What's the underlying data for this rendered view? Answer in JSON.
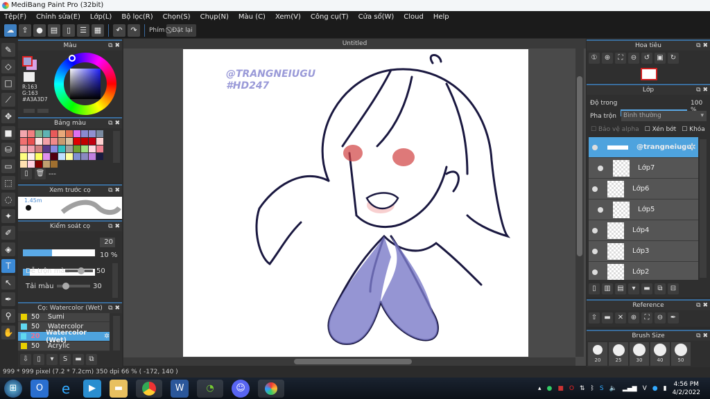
{
  "app": {
    "title": "MediBang Paint Pro (32bit)"
  },
  "menu": [
    "Tệp(F)",
    "Chỉnh sửa(E)",
    "Lớp(L)",
    "Bộ lọc(R)",
    "Chọn(S)",
    "Chụp(N)",
    "Màu (C)",
    "Xem(V)",
    "Công cụ(T)",
    "Cửa sổ(W)",
    "Cloud",
    "Help"
  ],
  "toolbar": {
    "shortcut_label": "Phím",
    "reset_label": "Đặt lại"
  },
  "color_panel": {
    "title": "Màu",
    "r": "R:163",
    "g": "G:163",
    "hex": "#A3A3D7",
    "primary": "#a3a3d7",
    "secondary": "#d7a3e6"
  },
  "palette_panel": {
    "title": "Bảng màu",
    "empty_label": "---",
    "colors": [
      "#f4a6ad",
      "#f08080",
      "#7fb18a",
      "#5fb3b3",
      "#e85a5a",
      "#e8a97a",
      "#e07050",
      "#e070f0",
      "#8a8ad0",
      "#9090d0",
      "#7a8aa0",
      "#f07070",
      "#e85050",
      "#ffe0e0",
      "#f4a0a8",
      "#f08a8a",
      "#c89a70",
      "#d8c0a0",
      "#e00000",
      "#c00000",
      "#c00010",
      "#ffd0d0",
      "#f0b0b0",
      "#f4a0b0",
      "#d08080",
      "#5a3a8a",
      "#8a8ae0",
      "#30c0c0",
      "#a0a0a0",
      "#70a030",
      "#a0e080",
      "#ffd8e0",
      "#f08090",
      "#ffff80",
      "#fff0f0",
      "#ffff60",
      "#e090f0",
      "#500010",
      "#c0e0ff",
      "#ffffa0",
      "#8090d0",
      "#8a8ac0",
      "#c080e0",
      "#1a1a40",
      "#ffe0b0",
      "#ffd0e0",
      "#800000",
      "#c0a070",
      "#a07030"
    ]
  },
  "brush_preview": {
    "title": "Xem trước cọ",
    "size": "1.45m"
  },
  "brush_control": {
    "title": "Kiểm soát cọ",
    "size_value": "20",
    "size_fraction": 0.4,
    "opacity_value": "10 %",
    "opacity_fraction": 0.1,
    "blend_label": "Dễ trộn màu",
    "blend_value": "50",
    "reload_label": "Tải màu",
    "reload_value": "30"
  },
  "brush_list": {
    "title": "Cọ: Watercolor (Wet)",
    "items": [
      {
        "size": "50",
        "name": "Sumi",
        "color": "#e8d000"
      },
      {
        "size": "50",
        "name": "Watercolor",
        "color": "#60d8f0"
      },
      {
        "size": "20",
        "name": "Watercolor (Wet)",
        "color": "#60d8f0",
        "selected": true
      },
      {
        "size": "50",
        "name": "Acrylic",
        "color": "#e8d000"
      }
    ]
  },
  "canvas": {
    "tab": "Untitled",
    "watermark_line1": "@TRANGNEIUGU",
    "watermark_line2": "#HD247"
  },
  "navigator": {
    "title": "Hoa tiêu"
  },
  "layers": {
    "title": "Lớp",
    "opacity_label": "Độ trong",
    "opacity_value": "100 %",
    "opacity_fraction": 1.0,
    "blend_label": "Pha trộn",
    "blend_value": "Bình thường",
    "protect_alpha": "Bảo vệ alpha",
    "clip": "Xén bớt",
    "lock": "Khóa",
    "items": [
      {
        "name": "@trangneiugu",
        "selected": true
      },
      {
        "name": "Lớp7"
      },
      {
        "name": "Lớp6"
      },
      {
        "name": "Lớp5"
      },
      {
        "name": "Lớp4"
      },
      {
        "name": "Lớp3"
      },
      {
        "name": "Lớp2"
      }
    ]
  },
  "reference": {
    "title": "Reference"
  },
  "brush_size": {
    "title": "Brush Size",
    "sizes": [
      "20",
      "25",
      "30",
      "40",
      "50"
    ]
  },
  "status": {
    "text": "999 * 999 pixel  (7.2 * 7.2cm)  350 dpi  66 %  ( -172, 140 )"
  },
  "taskbar": {
    "time": "4:56 PM",
    "date": "4/2/2022",
    "ime": "V"
  }
}
